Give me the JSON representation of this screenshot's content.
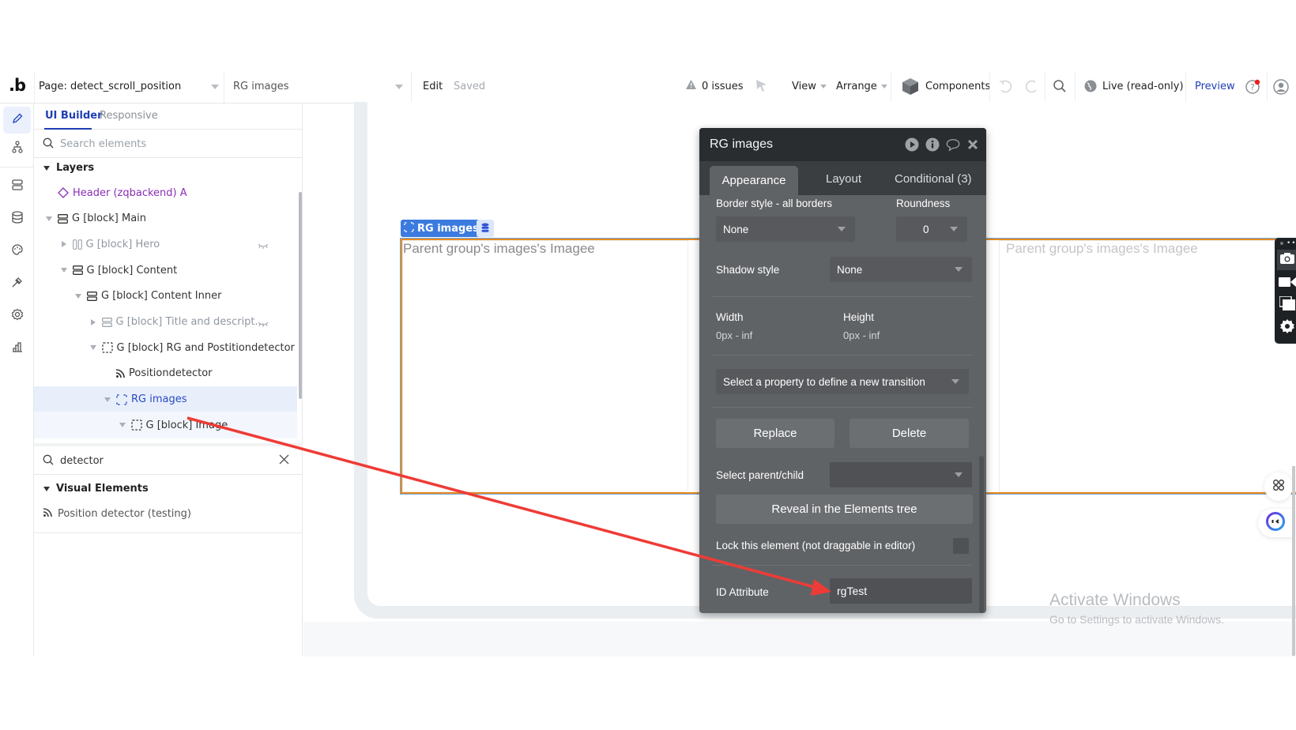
{
  "topbar": {
    "logo": ".b",
    "page_selector": "Page: detect_scroll_position",
    "element_selector": "RG images",
    "edit_label": "Edit",
    "save_status": "Saved",
    "issues": "0 issues",
    "view": "View",
    "arrange": "Arrange",
    "components": "Components",
    "live": "Live (read-only)",
    "preview": "Preview"
  },
  "rail": {
    "icons": [
      "pencil-icon",
      "hierarchy-icon",
      "server-icon",
      "database-icon",
      "palette-icon",
      "plug-icon",
      "settings-icon",
      "chart-icon"
    ]
  },
  "layers_panel": {
    "tabs": [
      {
        "label": "UI Builder",
        "active": true
      },
      {
        "label": "Responsive",
        "active": false
      }
    ],
    "search_placeholder": "Search elements",
    "section_title": "Layers",
    "rows": [
      {
        "label": "Header (zqbackend) A",
        "icon": "reusable-diamond-icon",
        "depth": 0,
        "toggle": "none",
        "style": "purple"
      },
      {
        "label": "G [block] Main",
        "icon": "group-rows-icon",
        "depth": 0,
        "toggle": "open",
        "style": "normal"
      },
      {
        "label": "G [block] Hero",
        "icon": "group-columns-icon",
        "depth": 1,
        "toggle": "closed",
        "style": "dim",
        "hidden": true
      },
      {
        "label": "G [block] Content",
        "icon": "group-rows-icon",
        "depth": 1,
        "toggle": "open",
        "style": "normal"
      },
      {
        "label": "G [block] Content Inner",
        "icon": "group-rows-icon",
        "depth": 2,
        "toggle": "open",
        "style": "normal"
      },
      {
        "label": "G [block] Title and descript...",
        "icon": "group-rows-icon",
        "depth": 3,
        "toggle": "closed",
        "style": "dim",
        "hidden": true
      },
      {
        "label": "G [block] RG and Postitiondetector",
        "icon": "group-dashed-icon",
        "depth": 3,
        "toggle": "open",
        "style": "normal"
      },
      {
        "label": "Positiondetector",
        "icon": "rss-icon",
        "depth": 4,
        "toggle": "none",
        "style": "normal"
      },
      {
        "label": "RG images",
        "icon": "repeating-group-icon",
        "depth": 4,
        "toggle": "open",
        "style": "selected"
      },
      {
        "label": "G [block] Image",
        "icon": "group-dashed-icon",
        "depth": 5,
        "toggle": "open",
        "style": "child-sel"
      }
    ],
    "element_search_value": "detector",
    "results_section": "Visual Elements",
    "results": [
      {
        "label": "Position detector (testing)",
        "icon": "rss-icon"
      }
    ]
  },
  "canvas": {
    "rg_label": "RG images",
    "cell_text": "Parent group's images's Imagee",
    "windows_notice": {
      "title": "Activate Windows",
      "subtitle": "Go to Settings to activate Windows."
    }
  },
  "panel": {
    "title": "RG images",
    "tabs": [
      {
        "label": "Appearance",
        "active": true
      },
      {
        "label": "Layout",
        "active": false
      },
      {
        "label": "Conditional (3)",
        "active": false
      }
    ],
    "border_style_label": "Border style - all borders",
    "border_style_value": "None",
    "roundness_label": "Roundness",
    "roundness_value": "0",
    "shadow_label": "Shadow style",
    "shadow_value": "None",
    "width_label": "Width",
    "width_value": "0px - inf",
    "height_label": "Height",
    "height_value": "0px - inf",
    "transition_placeholder": "Select a property to define a new transition",
    "replace_label": "Replace",
    "delete_label": "Delete",
    "parent_child_label": "Select parent/child",
    "parent_child_value": "",
    "reveal_label": "Reveal in the Elements tree",
    "lock_label": "Lock this element (not draggable in editor)",
    "lock_checked": false,
    "id_label": "ID Attribute",
    "id_value": "rgTest"
  },
  "annotation": {
    "arrow_color": "#ef3b36"
  },
  "colors": {
    "accent_blue": "#1f3fb3",
    "rg_label_bg": "#3b7be0",
    "selection_orange": "#e98a1f",
    "panel_bg": "#606366",
    "panel_header": "#2a2d30"
  }
}
